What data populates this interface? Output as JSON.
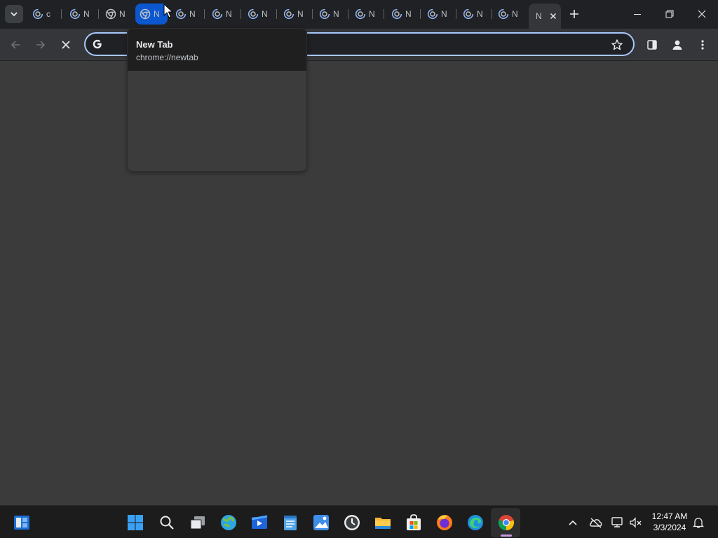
{
  "tabstrip": {
    "tabs": [
      {
        "title": "c",
        "favicon": "loading-favicon"
      },
      {
        "title": "N",
        "favicon": "loading-favicon"
      },
      {
        "title": "N",
        "favicon": "chrome-favicon"
      },
      {
        "title": "N",
        "favicon": "chrome-favicon",
        "state": "hovered"
      },
      {
        "title": "N",
        "favicon": "loading-favicon"
      },
      {
        "title": "N",
        "favicon": "loading-favicon"
      },
      {
        "title": "N",
        "favicon": "loading-favicon"
      },
      {
        "title": "N",
        "favicon": "loading-favicon"
      },
      {
        "title": "N",
        "favicon": "loading-favicon"
      },
      {
        "title": "N",
        "favicon": "loading-favicon"
      },
      {
        "title": "N",
        "favicon": "loading-favicon"
      },
      {
        "title": "N",
        "favicon": "loading-favicon"
      },
      {
        "title": "N",
        "favicon": "loading-favicon"
      },
      {
        "title": "N",
        "favicon": "loading-favicon"
      },
      {
        "title": "N",
        "favicon": "none",
        "state": "active"
      }
    ]
  },
  "hovercard": {
    "title": "New Tab",
    "url": "chrome://newtab"
  },
  "omnibox": {
    "value": "",
    "search_engine_icon": "google-g-icon"
  },
  "taskbar": {
    "apps": [
      "start",
      "search",
      "task-view",
      "maps",
      "movies",
      "notepad",
      "photos",
      "clock",
      "file-explorer",
      "store",
      "firefox",
      "edge",
      "chrome"
    ],
    "clock": {
      "time": "12:47 AM",
      "date": "3/3/2024"
    }
  },
  "colors": {
    "tabstrip_bg": "#202124",
    "toolbar_bg": "#35363a",
    "page_bg": "#3b3b3b",
    "hovered_tab": "#0b57d0",
    "taskbar_bg": "#1c1c1c"
  }
}
